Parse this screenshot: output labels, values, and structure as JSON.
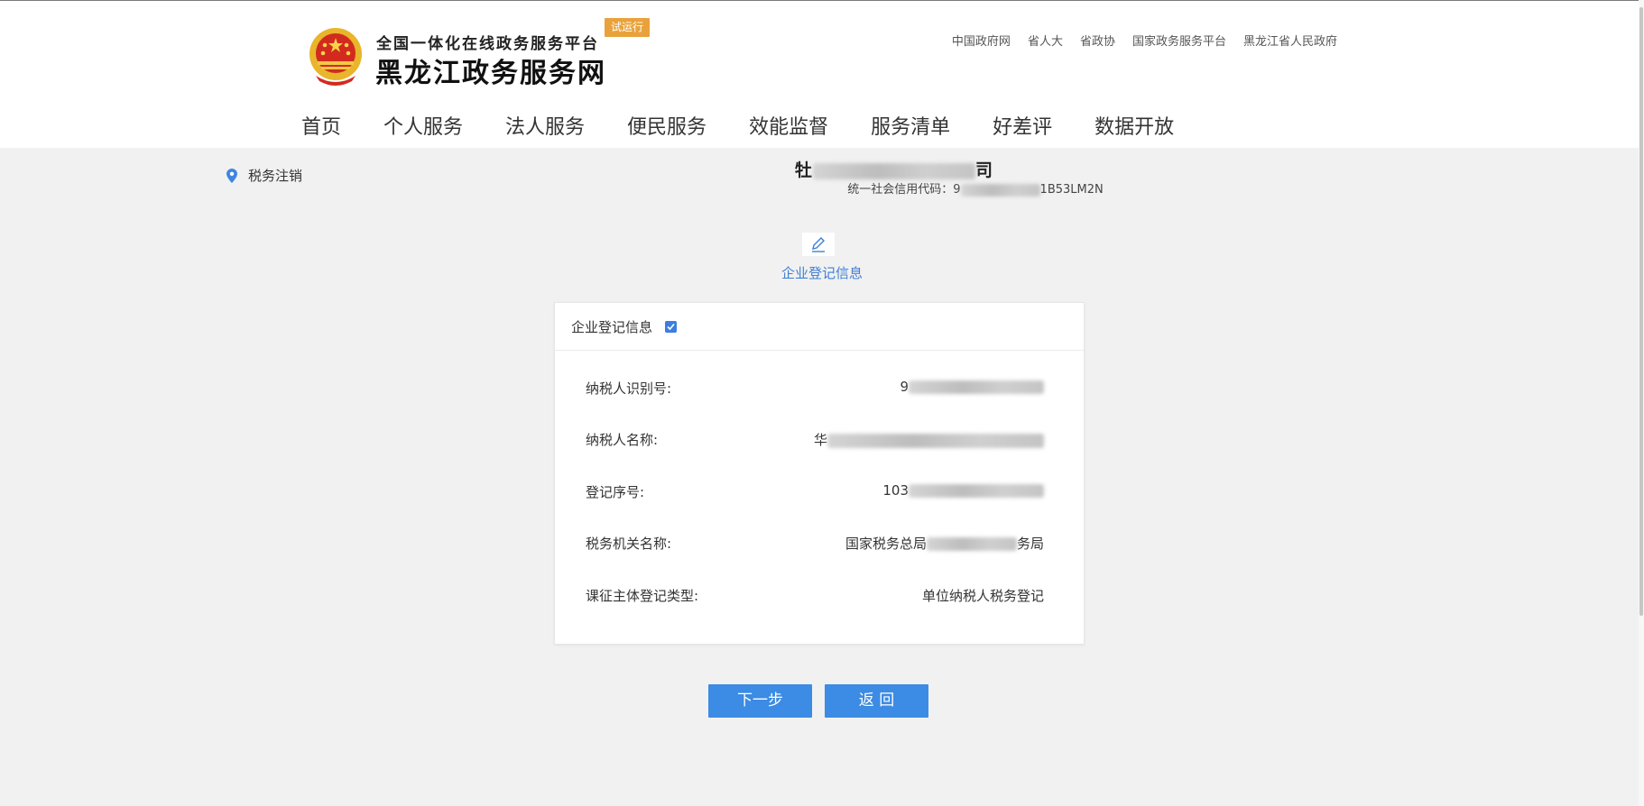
{
  "header": {
    "platform": "全国一体化在线政务服务平台",
    "trial_badge": "试运行",
    "site_name": "黑龙江政务服务网",
    "top_links": [
      "中国政府网",
      "省人大",
      "省政协",
      "国家政务服务平台",
      "黑龙江省人民政府"
    ]
  },
  "nav": [
    "首页",
    "个人服务",
    "法人服务",
    "便民服务",
    "效能监督",
    "服务清单",
    "好差评",
    "数据开放"
  ],
  "breadcrumb": "税务注销",
  "company": {
    "name_visible_start": "牡",
    "name_visible_end": "司",
    "credit_prefix": "统一社会信用代码：9",
    "credit_suffix": "1B53LM2N"
  },
  "step": {
    "label": "企业登记信息"
  },
  "card": {
    "title": "企业登记信息",
    "rows": [
      {
        "label": "纳税人识别号:",
        "value_start": "9",
        "value_end": ""
      },
      {
        "label": "纳税人名称:",
        "value_start": "华",
        "value_end": ""
      },
      {
        "label": "登记序号:",
        "value_start": "103",
        "value_end": ""
      },
      {
        "label": "税务机关名称:",
        "value_start": "国家税务总局",
        "value_end": "务局"
      },
      {
        "label": "课征主体登记类型:",
        "value_start": "单位纳税人税务登记",
        "value_end": ""
      }
    ]
  },
  "buttons": {
    "next": "下一步",
    "back": "返 回"
  },
  "colors": {
    "accent": "#3c8be4",
    "badge": "#e9a23b",
    "link": "#3f7fd6"
  }
}
